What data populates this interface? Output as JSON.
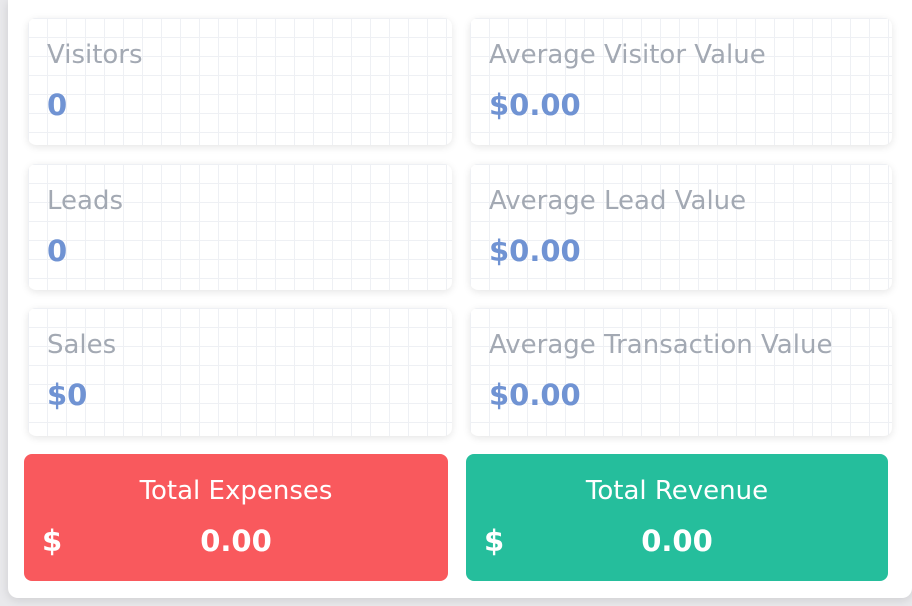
{
  "colors": {
    "label": "#a3a9b3",
    "value": "#7093d3",
    "expenses_bg": "#f9595d",
    "revenue_bg": "#25be9c"
  },
  "metrics": {
    "visitors": {
      "label": "Visitors",
      "value": "0"
    },
    "avg_visitor_value": {
      "label": "Average Visitor Value",
      "value": "$0.00"
    },
    "leads": {
      "label": "Leads",
      "value": "0"
    },
    "avg_lead_value": {
      "label": "Average Lead Value",
      "value": "$0.00"
    },
    "sales": {
      "label": "Sales",
      "value": "$0"
    },
    "avg_transaction_value": {
      "label": "Average Transaction Value",
      "value": "$0.00"
    }
  },
  "totals": {
    "expenses": {
      "label": "Total Expenses",
      "currency": "$",
      "value": "0.00"
    },
    "revenue": {
      "label": "Total Revenue",
      "currency": "$",
      "value": "0.00"
    }
  }
}
